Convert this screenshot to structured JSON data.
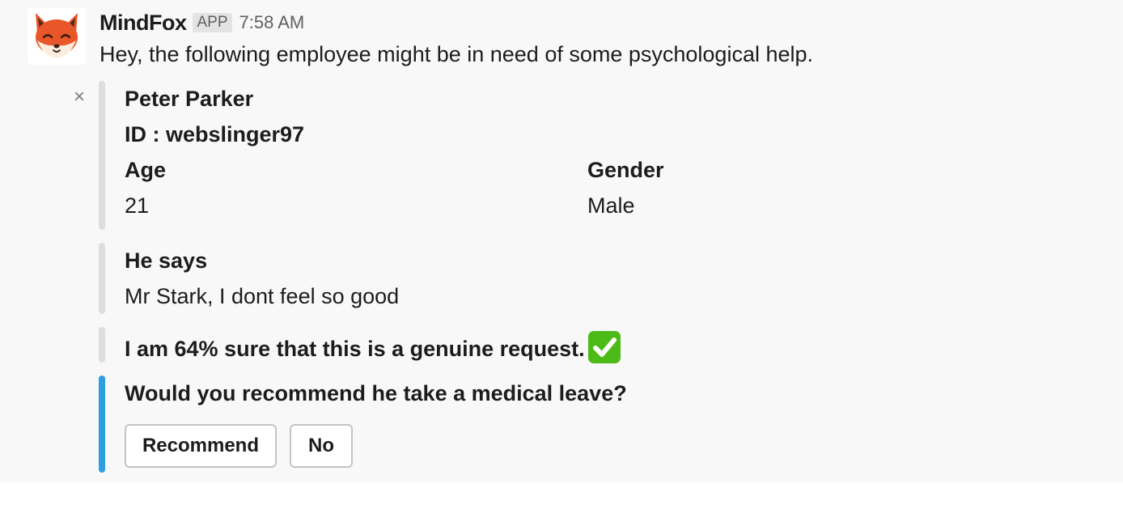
{
  "message": {
    "sender": "MindFox",
    "badge": "APP",
    "timestamp": "7:58 AM",
    "text": "Hey, the following employee might be in need of some psychological help.",
    "avatar_icon": "fox-avatar-icon",
    "dismiss_symbol": "×"
  },
  "employee": {
    "name": "Peter Parker",
    "id_line": "ID : webslinger97",
    "fields": [
      {
        "label": "Age",
        "value": "21"
      },
      {
        "label": "Gender",
        "value": "Male"
      }
    ]
  },
  "quote": {
    "label": "He says",
    "text": "Mr Stark, I dont feel so good"
  },
  "confidence": {
    "text": "I am 64% sure that this is a genuine request.",
    "icon": "white-check-mark-icon"
  },
  "action": {
    "question": "Would you recommend he take a medical leave?",
    "buttons": [
      {
        "label": "Recommend"
      },
      {
        "label": "No"
      }
    ]
  },
  "colors": {
    "accent_bar": "#2d9ee0",
    "neutral_bar": "#dddddd",
    "check_green": "#4cbb17"
  }
}
